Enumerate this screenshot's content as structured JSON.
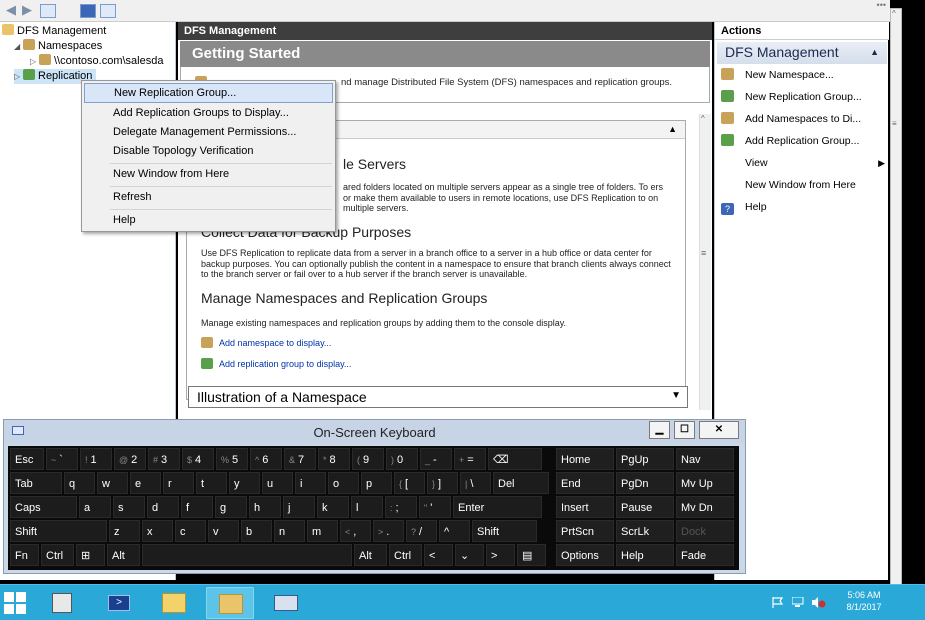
{
  "tree": {
    "root": "DFS Management",
    "namespaces": "Namespaces",
    "namespace_item": "\\\\contoso.com\\salesda",
    "replication": "Replication"
  },
  "center": {
    "header": "DFS Management",
    "getting_started": "Getting Started",
    "intro_text": "nd manage Distributed File System (DFS) namespaces and replication groups.",
    "overview_head": "",
    "sec1_title": "le Servers",
    "sec1_text": "ared folders located on multiple servers appear as a single tree of folders. To ers or make them available to users in remote locations, use DFS Replication to on multiple servers.",
    "sec2_title": "Collect Data for Backup Purposes",
    "sec2_text": "Use DFS Replication to replicate data from a server in a branch office to a server in a hub office or data center for backup purposes. You can optionally publish the content in a namespace to ensure that branch clients always connect to the branch server or fail over to a hub server if the branch server is unavailable.",
    "sec3_title": "Manage Namespaces and Replication Groups",
    "sec3_text": "Manage existing namespaces and replication groups by adding them to the console display.",
    "link1": "Add namespace to display...",
    "link2": "Add replication group to display...",
    "illustration": "Illustration of a Namespace"
  },
  "actions": {
    "header": "Actions",
    "section": "DFS Management",
    "items": [
      {
        "label": "New Namespace...",
        "icon": "namespace-icon"
      },
      {
        "label": "New Replication Group...",
        "icon": "replication-group-icon"
      },
      {
        "label": "Add Namespaces to Di...",
        "icon": "namespace-icon"
      },
      {
        "label": "Add Replication Group...",
        "icon": "replication-group-icon"
      },
      {
        "label": "View",
        "icon": ""
      },
      {
        "label": "New Window from Here",
        "icon": ""
      },
      {
        "label": "Help",
        "icon": "help-icon"
      }
    ]
  },
  "context_menu": {
    "items": [
      "New Replication Group...",
      "Add Replication Groups to Display...",
      "Delegate Management Permissions...",
      "Disable Topology Verification",
      "New Window from Here",
      "Refresh",
      "Help"
    ]
  },
  "osk": {
    "title": "On-Screen Keyboard",
    "row1": [
      "Esc",
      "~ `",
      "! 1",
      "@ 2",
      "# 3",
      "$ 4",
      "% 5",
      "^ 6",
      "& 7",
      "* 8",
      "( 9",
      ") 0",
      "_ -",
      "+ =",
      "⌫"
    ],
    "row2": [
      "Tab",
      "q",
      "w",
      "e",
      "r",
      "t",
      "y",
      "u",
      "i",
      "o",
      "p",
      "{ [",
      "} ]",
      "| \\",
      "Del"
    ],
    "row3": [
      "Caps",
      "a",
      "s",
      "d",
      "f",
      "g",
      "h",
      "j",
      "k",
      "l",
      ": ;",
      "\" '",
      "Enter"
    ],
    "row4": [
      "Shift",
      "z",
      "x",
      "c",
      "v",
      "b",
      "n",
      "m",
      "< ,",
      "> .",
      "? /",
      "^",
      "Shift"
    ],
    "row5": [
      "Fn",
      "Ctrl",
      "⊞",
      "Alt",
      "",
      "Alt",
      "Ctrl",
      "<",
      "⌄",
      ">",
      "▤"
    ],
    "nav": [
      [
        "Home",
        "PgUp",
        "Nav"
      ],
      [
        "End",
        "PgDn",
        "Mv Up"
      ],
      [
        "Insert",
        "Pause",
        "Mv Dn"
      ],
      [
        "PrtScn",
        "ScrLk",
        "Dock"
      ],
      [
        "Options",
        "Help",
        "Fade"
      ]
    ]
  },
  "taskbar": {
    "time": "5:06 AM",
    "date": "8/1/2017"
  },
  "colors": {
    "taskbar": "#2aa9d8",
    "keyboard_key": "#1c1c1c",
    "menu_highlight": "#d8e6f7",
    "link": "#0033aa"
  }
}
